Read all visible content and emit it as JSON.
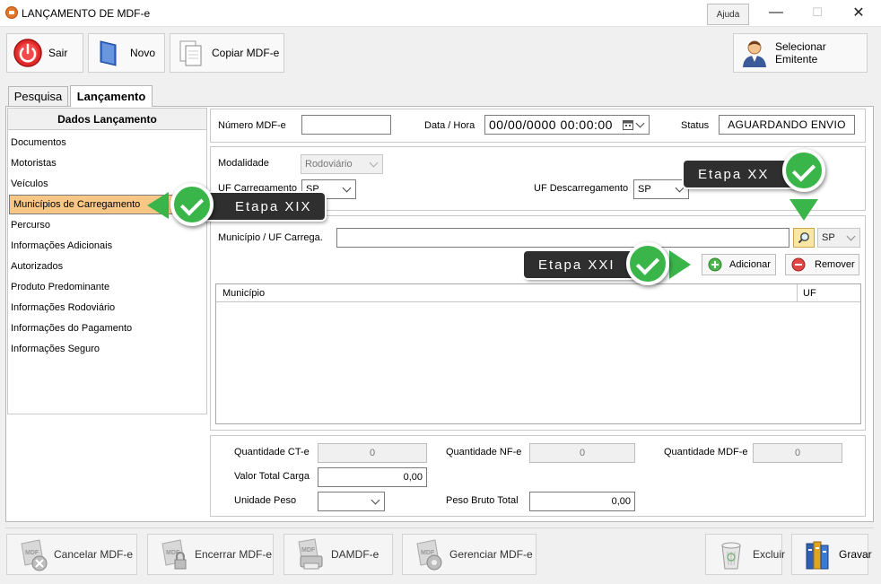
{
  "window": {
    "title": "LANÇAMENTO DE MDF-e",
    "help": "Ajuda",
    "minimize": "—",
    "maximize": "☐",
    "close": "✕"
  },
  "toolbar": {
    "sair": "Sair",
    "novo": "Novo",
    "copiar": "Copiar MDF-e",
    "emitente": "Selecionar Emitente"
  },
  "tabs": [
    {
      "label": "Pesquisa"
    },
    {
      "label": "Lançamento"
    }
  ],
  "sidebar": {
    "title": "Dados Lançamento",
    "items": [
      {
        "label": "Documentos"
      },
      {
        "label": "Motoristas"
      },
      {
        "label": "Veículos"
      },
      {
        "label": "Municípios de Carregamento"
      },
      {
        "label": "Percurso"
      },
      {
        "label": "Informações Adicionais"
      },
      {
        "label": "Autorizados"
      },
      {
        "label": "Produto Predominante"
      },
      {
        "label": "Informações Rodoviário"
      },
      {
        "label": "Informações do Pagamento"
      },
      {
        "label": "Informações Seguro"
      }
    ],
    "selected_index": 3
  },
  "header": {
    "numero_label": "Número MDF-e",
    "numero_value": "",
    "data_label": "Data / Hora",
    "data_value": "00/00/0000 00:00:00",
    "status_label": "Status",
    "status_value": "AGUARDANDO ENVIO"
  },
  "details": {
    "modalidade_label": "Modalidade",
    "modalidade_value": "Rodoviário",
    "uf_carreg_label": "UF Carregamento",
    "uf_carreg_value": "SP",
    "uf_descarreg_label": "UF Descarregamento",
    "uf_descarreg_value": "SP"
  },
  "municipio": {
    "label": "Município / UF Carrega.",
    "value": "",
    "uf_value": "SP",
    "adicionar": "Adicionar",
    "remover": "Remover",
    "columns": [
      "Município",
      "UF"
    ],
    "rows": []
  },
  "totals": {
    "qtd_cte_label": "Quantidade CT-e",
    "qtd_cte_value": "0",
    "qtd_nfe_label": "Quantidade NF-e",
    "qtd_nfe_value": "0",
    "qtd_mdfe_label": "Quantidade MDF-e",
    "qtd_mdfe_value": "0",
    "valor_total_label": "Valor Total Carga",
    "valor_total_value": "0,00",
    "unidade_peso_label": "Unidade Peso",
    "unidade_peso_value": "",
    "peso_bruto_label": "Peso Bruto Total",
    "peso_bruto_value": "0,00"
  },
  "bottombar": {
    "cancelar": "Cancelar MDF-e",
    "encerrar": "Encerrar MDF-e",
    "damdfe": "DAMDF-e",
    "gerenciar": "Gerenciar MDF-e",
    "excluir": "Excluir",
    "gravar": "Gravar"
  },
  "callouts": {
    "step19": "Etapa XIX",
    "step20": "Etapa XX",
    "step21": "Etapa XXI"
  },
  "colors": {
    "callout_bg": "#2f2f2f",
    "check_green": "#3ab54a",
    "selected_item": "#f9c785"
  }
}
